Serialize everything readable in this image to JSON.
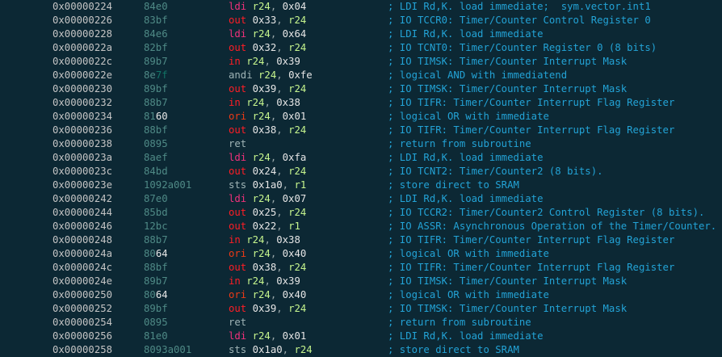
{
  "colors": {
    "background": "#0c2834",
    "address": "#c4c4c4",
    "bytes": "#4f8a86",
    "ldi": "#f0317b",
    "io": "#ff1d25",
    "ori": "#ee3a16",
    "register": "#c6f58e",
    "comment": "#23a3d6"
  },
  "rows": [
    {
      "addr": "0x00000224",
      "bytes": "84e0",
      "op": "ldi",
      "args": [
        "r24",
        "0x04"
      ],
      "comment": "; LDI Rd,K. load immediate;  sym.vector.int1"
    },
    {
      "addr": "0x00000226",
      "bytes": "83bf",
      "op": "out",
      "args": [
        "0x33",
        "r24"
      ],
      "comment": "; IO TCCR0: Timer/Counter Control Register 0"
    },
    {
      "addr": "0x00000228",
      "bytes": "84e6",
      "op": "ldi",
      "args": [
        "r24",
        "0x64"
      ],
      "comment": "; LDI Rd,K. load immediate"
    },
    {
      "addr": "0x0000022a",
      "bytes": "82bf",
      "op": "out",
      "args": [
        "0x32",
        "r24"
      ],
      "comment": "; IO TCNT0: Timer/Counter Register 0 (8 bits)"
    },
    {
      "addr": "0x0000022c",
      "bytes": "89b7",
      "op": "in",
      "args": [
        "r24",
        "0x39"
      ],
      "comment": "; IO TIMSK: Timer/Counter Interrupt Mask"
    },
    {
      "addr": "0x0000022e",
      "bytes": "8e",
      "bytes_hl": "7f",
      "hl": "dark",
      "op": "andi",
      "args": [
        "r24",
        "0xfe"
      ],
      "comment": "; logical AND with immediatend"
    },
    {
      "addr": "0x00000230",
      "bytes": "89bf",
      "op": "out",
      "args": [
        "0x39",
        "r24"
      ],
      "comment": "; IO TIMSK: Timer/Counter Interrupt Mask"
    },
    {
      "addr": "0x00000232",
      "bytes": "88b7",
      "op": "in",
      "args": [
        "r24",
        "0x38"
      ],
      "comment": "; IO TIFR: Timer/Counter Interrupt Flag Register"
    },
    {
      "addr": "0x00000234",
      "bytes": "81",
      "bytes_hl": "60",
      "hl": "white",
      "op": "ori",
      "args": [
        "r24",
        "0x01"
      ],
      "comment": "; logical OR with immediate"
    },
    {
      "addr": "0x00000236",
      "bytes": "88bf",
      "op": "out",
      "args": [
        "0x38",
        "r24"
      ],
      "comment": "; IO TIFR: Timer/Counter Interrupt Flag Register"
    },
    {
      "addr": "0x00000238",
      "bytes": "0895",
      "op": "ret",
      "args": [],
      "comment": "; return from subroutine"
    },
    {
      "addr": "0x0000023a",
      "bytes": "8aef",
      "op": "ldi",
      "args": [
        "r24",
        "0xfa"
      ],
      "comment": "; LDI Rd,K. load immediate"
    },
    {
      "addr": "0x0000023c",
      "bytes": "84bd",
      "op": "out",
      "args": [
        "0x24",
        "r24"
      ],
      "comment": "; IO TCNT2: Timer/Counter2 (8 bits)."
    },
    {
      "addr": "0x0000023e",
      "bytes": "1092a001",
      "op": "sts",
      "args": [
        "0x1a0",
        "r1"
      ],
      "comment": "; store direct to SRAM"
    },
    {
      "addr": "0x00000242",
      "bytes": "87e0",
      "op": "ldi",
      "args": [
        "r24",
        "0x07"
      ],
      "comment": "; LDI Rd,K. load immediate"
    },
    {
      "addr": "0x00000244",
      "bytes": "85bd",
      "op": "out",
      "args": [
        "0x25",
        "r24"
      ],
      "comment": "; IO TCCR2: Timer/Counter2 Control Register (8 bits)."
    },
    {
      "addr": "0x00000246",
      "bytes": "12bc",
      "op": "out",
      "args": [
        "0x22",
        "r1"
      ],
      "comment": "; IO ASSR: Asynchronous Operation of the Timer/Counter."
    },
    {
      "addr": "0x00000248",
      "bytes": "88b7",
      "op": "in",
      "args": [
        "r24",
        "0x38"
      ],
      "comment": "; IO TIFR: Timer/Counter Interrupt Flag Register"
    },
    {
      "addr": "0x0000024a",
      "bytes": "80",
      "bytes_hl": "64",
      "hl": "white",
      "op": "ori",
      "args": [
        "r24",
        "0x40"
      ],
      "comment": "; logical OR with immediate"
    },
    {
      "addr": "0x0000024c",
      "bytes": "88bf",
      "op": "out",
      "args": [
        "0x38",
        "r24"
      ],
      "comment": "; IO TIFR: Timer/Counter Interrupt Flag Register"
    },
    {
      "addr": "0x0000024e",
      "bytes": "89b7",
      "op": "in",
      "args": [
        "r24",
        "0x39"
      ],
      "comment": "; IO TIMSK: Timer/Counter Interrupt Mask"
    },
    {
      "addr": "0x00000250",
      "bytes": "80",
      "bytes_hl": "64",
      "hl": "white",
      "op": "ori",
      "args": [
        "r24",
        "0x40"
      ],
      "comment": "; logical OR with immediate"
    },
    {
      "addr": "0x00000252",
      "bytes": "89bf",
      "op": "out",
      "args": [
        "0x39",
        "r24"
      ],
      "comment": "; IO TIMSK: Timer/Counter Interrupt Mask"
    },
    {
      "addr": "0x00000254",
      "bytes": "0895",
      "op": "ret",
      "args": [],
      "comment": "; return from subroutine"
    },
    {
      "addr": "0x00000256",
      "bytes": "81e0",
      "op": "ldi",
      "args": [
        "r24",
        "0x01"
      ],
      "comment": "; LDI Rd,K. load immediate"
    },
    {
      "addr": "0x00000258",
      "bytes": "8093a001",
      "op": "sts",
      "args": [
        "0x1a0",
        "r24"
      ],
      "comment": "; store direct to SRAM"
    }
  ]
}
